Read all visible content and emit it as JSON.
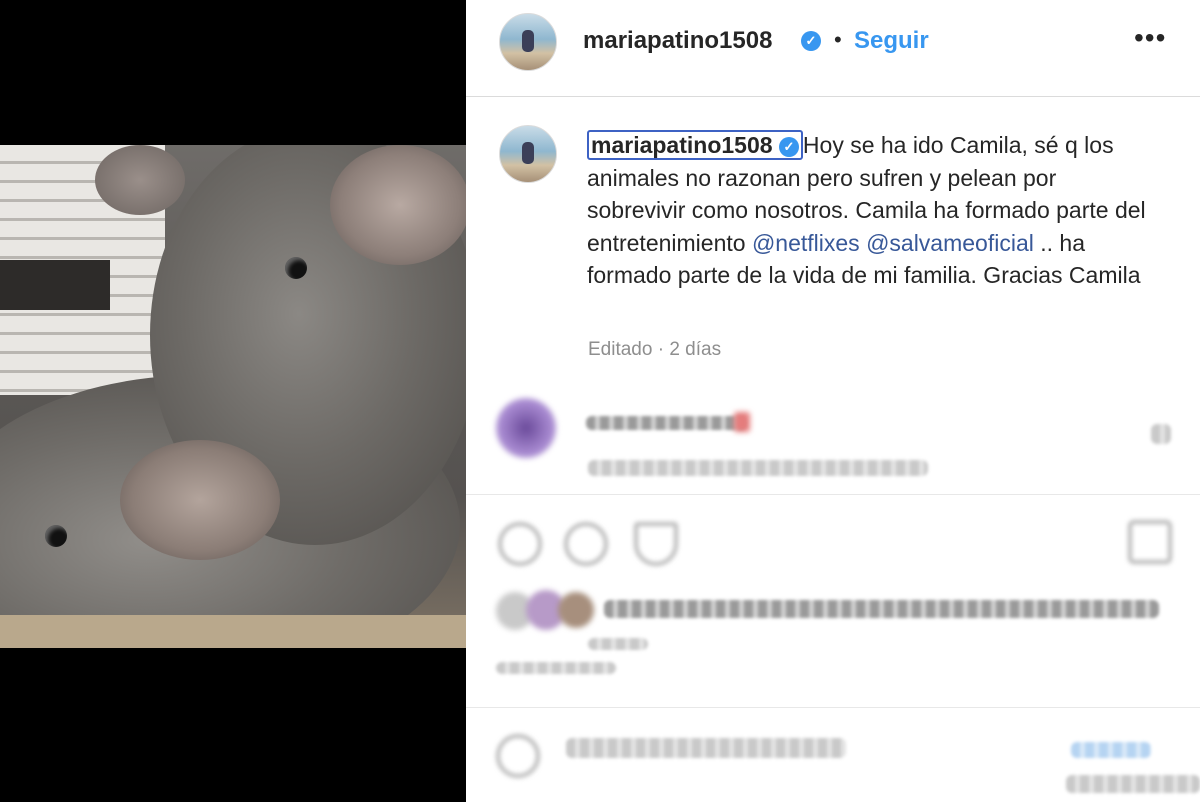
{
  "post": {
    "username": "mariapatino1508",
    "verified_mark": "✓",
    "separator": "•",
    "follow_label": "Seguir",
    "more_label": "•••"
  },
  "caption": {
    "username": "mariapatino1508",
    "text_1": "Hoy se ha ido Camila, sé q los animales no razonan pero sufren y pelean por sobrevivir como nosotros. Camila ha formado parte del entretenimiento ",
    "mention_1": "@netflixes",
    "text_2": " ",
    "mention_2": "@salvameoficial",
    "text_3": " .. ha formado parte de la vida de mi familia. Gracias Camila",
    "meta": "Editado · 2 días"
  },
  "icons": {
    "avatar": "avatar-image",
    "verified": "verified-badge-icon",
    "like": "heart-icon",
    "comment": "comment-icon",
    "share": "share-icon",
    "save": "bookmark-icon",
    "emoji": "emoji-icon"
  },
  "colors": {
    "accent": "#3897f0",
    "mention": "#385898",
    "text": "#262626",
    "muted": "#8e8e8e"
  }
}
